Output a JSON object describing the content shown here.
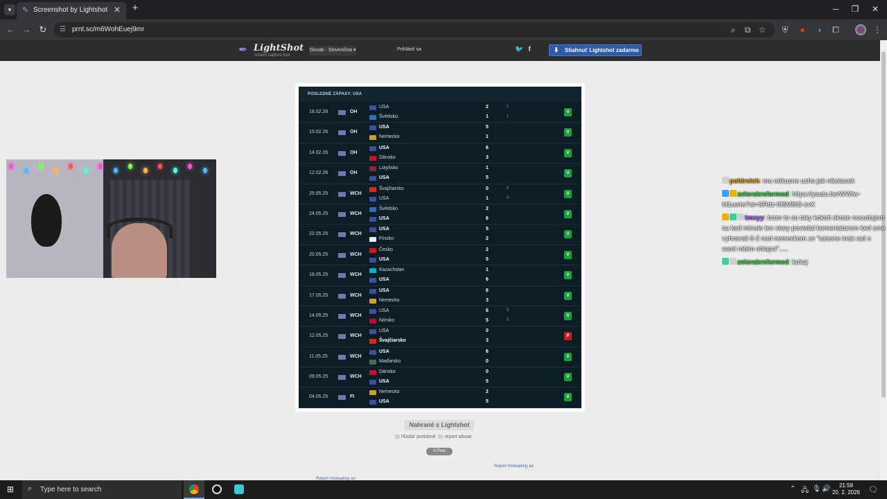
{
  "browser": {
    "tab_title": "Screenshot by Lightshot",
    "tab_close": "✕",
    "new_tab": "+",
    "url": "prnt.sc/m6WohEuej9mr",
    "window_controls": [
      "─",
      "❐",
      "✕"
    ]
  },
  "lightshot": {
    "brand": "LightShot",
    "tagline": "screen capture tool",
    "language": "Slovak - Slovenčina",
    "login": "Prihlásiť sa",
    "download": "Stiahnuť Lightshot zadarmo",
    "uploaded_with": "Nahrané s Lightshot",
    "search_similar": "hľadať podobné",
    "report_abuse": "report abuse",
    "x_post": "X Post",
    "report_ad_1": "Report misleading ad",
    "report_ad_2": "Report misleading ad"
  },
  "screenshot": {
    "header": "POSLEDNÉ ZÁPASY: USA",
    "matches": [
      {
        "date": "18.02.26",
        "comp": "OH",
        "t1": "USA",
        "t1_bold": false,
        "s1": "2",
        "p1": "1",
        "t2": "Švédsko",
        "t2_bold": false,
        "s2": "1",
        "p2": "1",
        "result": "V"
      },
      {
        "date": "15.02.26",
        "comp": "OH",
        "t1": "USA",
        "t1_bold": true,
        "s1": "5",
        "p1": "",
        "t2": "Nemecko",
        "t2_bold": false,
        "s2": "1",
        "p2": "",
        "result": "V"
      },
      {
        "date": "14.02.26",
        "comp": "OH",
        "t1": "USA",
        "t1_bold": true,
        "s1": "6",
        "p1": "",
        "t2": "Dánsko",
        "t2_bold": false,
        "s2": "3",
        "p2": "",
        "result": "V"
      },
      {
        "date": "12.02.26",
        "comp": "OH",
        "t1": "Lotyšsko",
        "t1_bold": false,
        "s1": "1",
        "p1": "",
        "t2": "USA",
        "t2_bold": true,
        "s2": "5",
        "p2": "",
        "result": "V"
      },
      {
        "date": "25.05.25",
        "comp": "WCH",
        "t1": "Švajčiarsko",
        "t1_bold": false,
        "s1": "0",
        "p1": "0",
        "t2": "USA",
        "t2_bold": false,
        "s2": "1",
        "p2": "0",
        "result": "V"
      },
      {
        "date": "24.05.25",
        "comp": "WCH",
        "t1": "Švédsko",
        "t1_bold": false,
        "s1": "2",
        "p1": "",
        "t2": "USA",
        "t2_bold": true,
        "s2": "6",
        "p2": "",
        "result": "V"
      },
      {
        "date": "22.05.25",
        "comp": "WCH",
        "t1": "USA",
        "t1_bold": true,
        "s1": "5",
        "p1": "",
        "t2": "Fínsko",
        "t2_bold": false,
        "s2": "2",
        "p2": "",
        "result": "V"
      },
      {
        "date": "20.05.25",
        "comp": "WCH",
        "t1": "Česko",
        "t1_bold": false,
        "s1": "2",
        "p1": "",
        "t2": "USA",
        "t2_bold": true,
        "s2": "5",
        "p2": "",
        "result": "V"
      },
      {
        "date": "18.05.25",
        "comp": "WCH",
        "t1": "Kazachstan",
        "t1_bold": false,
        "s1": "1",
        "p1": "",
        "t2": "USA",
        "t2_bold": true,
        "s2": "6",
        "p2": "",
        "result": "V"
      },
      {
        "date": "17.05.25",
        "comp": "WCH",
        "t1": "USA",
        "t1_bold": true,
        "s1": "6",
        "p1": "",
        "t2": "Nemecko",
        "t2_bold": false,
        "s2": "3",
        "p2": "",
        "result": "V"
      },
      {
        "date": "14.05.25",
        "comp": "WCH",
        "t1": "USA",
        "t1_bold": false,
        "s1": "6",
        "p1": "5",
        "t2": "Nórsko",
        "t2_bold": false,
        "s2": "5",
        "p2": "5",
        "result": "V"
      },
      {
        "date": "12.05.25",
        "comp": "WCH",
        "t1": "USA",
        "t1_bold": false,
        "s1": "0",
        "p1": "",
        "t2": "Švajčiarsko",
        "t2_bold": true,
        "s2": "3",
        "p2": "",
        "result": "P"
      },
      {
        "date": "11.05.25",
        "comp": "WCH",
        "t1": "USA",
        "t1_bold": true,
        "s1": "6",
        "p1": "",
        "t2": "Maďarsko",
        "t2_bold": false,
        "s2": "0",
        "p2": "",
        "result": "V"
      },
      {
        "date": "09.05.25",
        "comp": "WCH",
        "t1": "Dánsko",
        "t1_bold": false,
        "s1": "0",
        "p1": "",
        "t2": "USA",
        "t2_bold": true,
        "s2": "5",
        "p2": "",
        "result": "V"
      },
      {
        "date": "04.05.25",
        "comp": "FI",
        "t1": "Nemecko",
        "t1_bold": false,
        "s1": "2",
        "p1": "",
        "t2": "USA",
        "t2_bold": true,
        "s2": "5",
        "p2": "",
        "result": "V"
      }
    ]
  },
  "flags": {
    "USA": "#3b4f9a",
    "Švédsko": "#2f6fb3",
    "Nemecko": "#c9a227",
    "Dánsko": "#c8102e",
    "Lotyšsko": "#8e2635",
    "Švajčiarsko": "#d52b1e",
    "Fínsko": "#e8eef5",
    "Česko": "#d7141a",
    "Kazachstan": "#00afca",
    "Nórsko": "#ba0c2f",
    "Maďarsko": "#477050"
  },
  "result_colors": {
    "V": "#1e9e3e",
    "P": "#c81e1e"
  },
  "chat": [
    {
      "user": "pohlreich",
      "color": "#f4a000",
      "text": ": mu odkusne ucho jak nikolasek"
    },
    {
      "user": "zelorakreformed",
      "color": "#2fe03a",
      "text": ": https://youtu.be/WWtw-M1uwIw?si=SRdz-0f6M8tG-zvK"
    },
    {
      "user": "tmxyy",
      "color": "#b05cff",
      "text": ": boze to su taky kokoti akoze necudujem sa ked minule ten stary povedal komentatorom ked sme vyhravali 6-2 nad nemeckom ze \"uzasne inak rad s vami robim chlapci\"....."
    },
    {
      "user": "zelorakreformed",
      "color": "#2fe03a",
      "text": ": kukaj"
    }
  ],
  "taskbar": {
    "search_placeholder": "Type here to search",
    "time": "21:59",
    "date": "20. 2. 2026"
  }
}
